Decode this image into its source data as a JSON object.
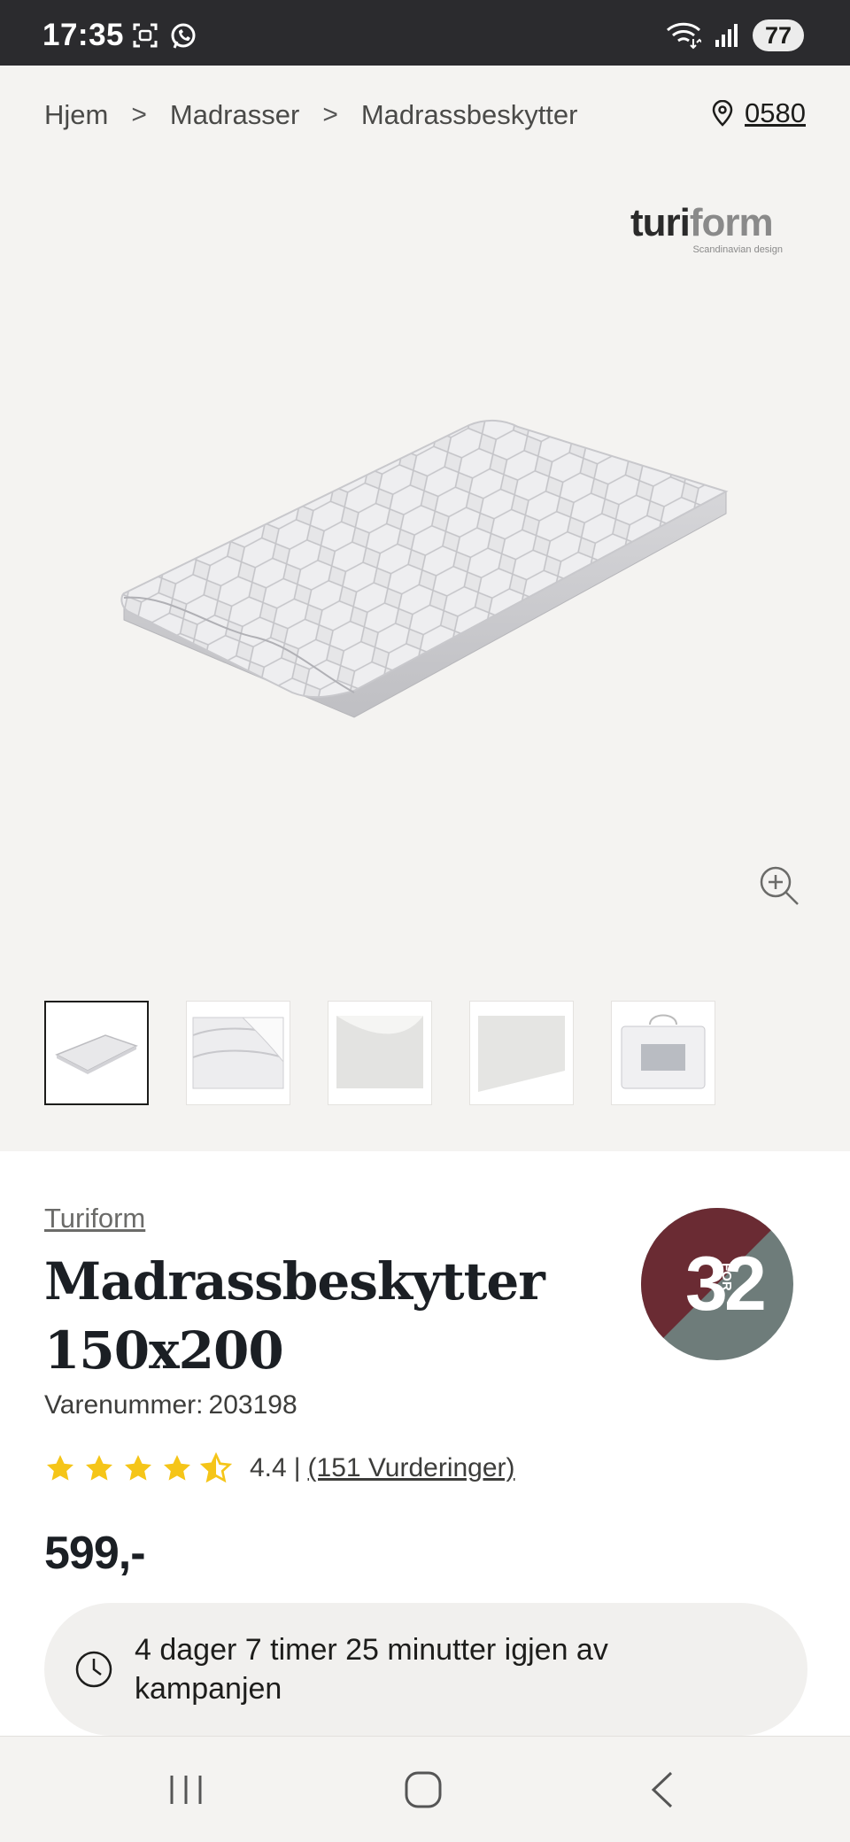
{
  "status_bar": {
    "time": "17:35",
    "battery": "77",
    "icons": [
      "screenshot-icon",
      "whatsapp-icon",
      "wifi-icon",
      "signal-icon"
    ]
  },
  "breadcrumb": {
    "items": [
      "Hjem",
      "Madrasser",
      "Madrassbeskytter"
    ],
    "separator": ">"
  },
  "store": {
    "code": "0580"
  },
  "brand_logo": {
    "word_dark": "turi",
    "word_light": "form",
    "tagline": "Scandinavian design"
  },
  "gallery": {
    "thumbnail_count": 5,
    "active_index": 0
  },
  "product": {
    "brand": "Turiform",
    "title": "Madrassbeskytter 150x200",
    "sku_label": "Varenummer:",
    "sku": "203198",
    "rating": 4.4,
    "rating_text": "4.4",
    "reviews_text": "(151 Vurderinger)",
    "price": "599,-"
  },
  "promo": {
    "big_left": "3",
    "small": "FOR",
    "big_right": "2",
    "color_top": "#6a2b33",
    "color_bottom": "#6e7c7a"
  },
  "countdown": {
    "text": "4 dager 7 timer 25 minutter igjen av kampanjen"
  },
  "colors": {
    "panel_bg": "#f4f3f1",
    "star": "#f5c518",
    "text_dark": "#1b1f24"
  }
}
